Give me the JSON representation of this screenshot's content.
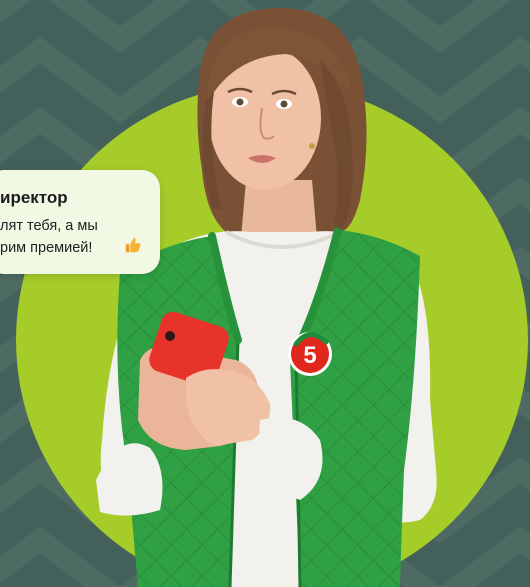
{
  "bubble": {
    "title": "иректор",
    "line1": "лят тебя, а мы",
    "line2": "рим премией!",
    "emoji_icon": "thumbs-up-icon"
  },
  "logo": {
    "text": "5"
  },
  "colors": {
    "background": "#43615a",
    "circle": "#a6cc2a",
    "vest": "#2fa043",
    "phone": "#e8332a",
    "logo_red": "#e1261c",
    "bubble": "#f1f8e4"
  }
}
